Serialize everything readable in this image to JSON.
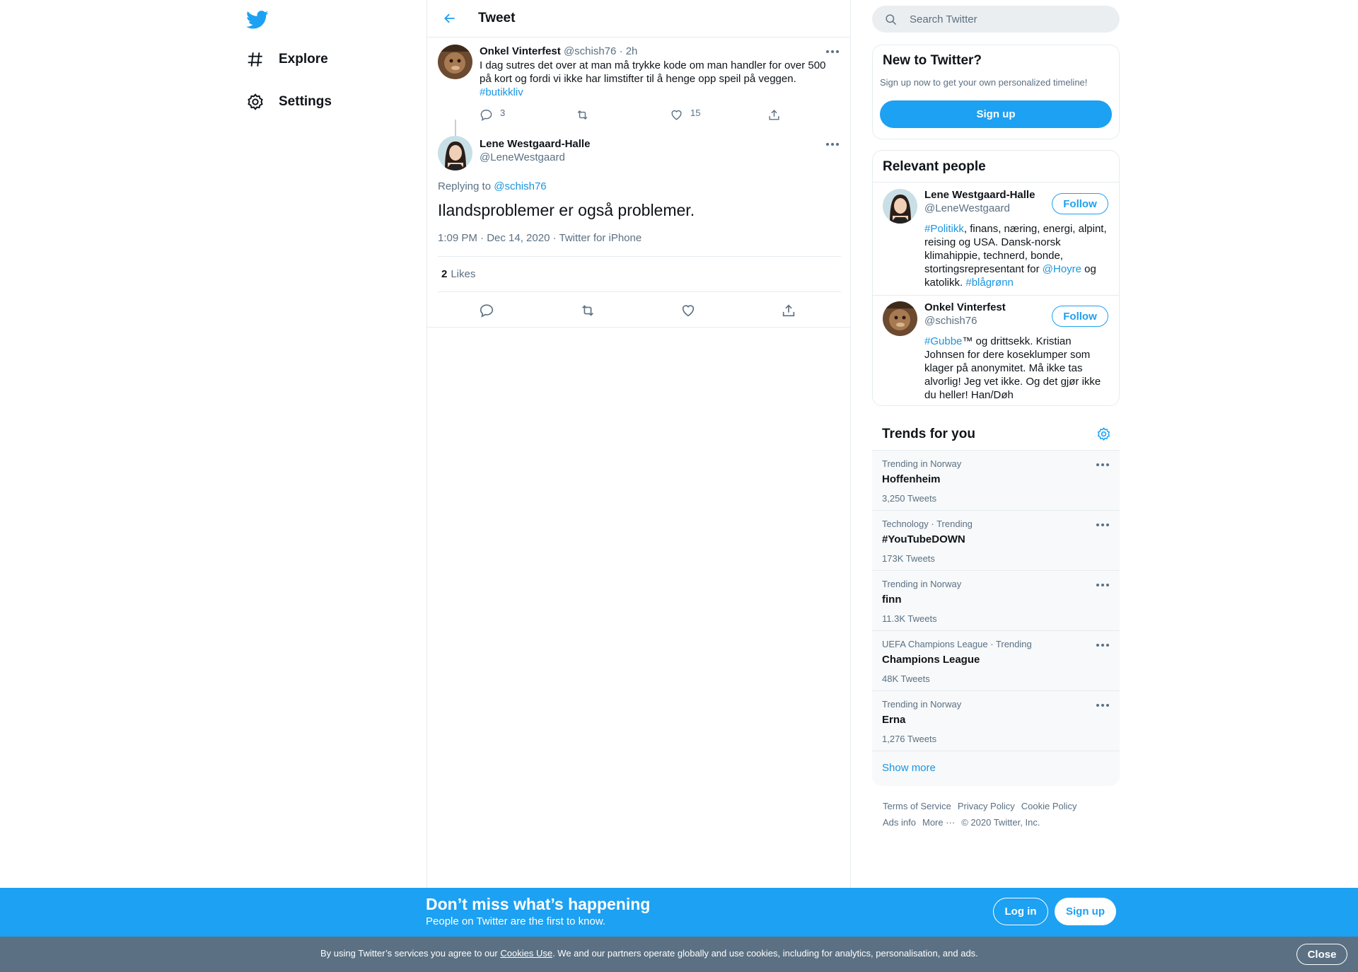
{
  "colors": {
    "accent": "#1da1f2",
    "link": "#1b95e0",
    "muted": "#5b7083",
    "cookie_bar": "#5b7083"
  },
  "nav": {
    "logo_icon": "twitter-bird-icon",
    "items": [
      {
        "label": "Explore",
        "icon": "hashtag-icon"
      },
      {
        "label": "Settings",
        "icon": "gear-icon"
      }
    ]
  },
  "header": {
    "title": "Tweet"
  },
  "parent_tweet": {
    "name": "Onkel Vinterfest",
    "handle": "@schish76",
    "time": "· 2h",
    "text": "I dag sutres det over at man må trykke kode om man handler for over 500 på kort og fordi vi ikke har limstifter til å henge opp speil på veggen.",
    "hashtag": "#butikkliv",
    "reply_count": "3",
    "like_count": "15"
  },
  "main_tweet": {
    "name": "Lene Westgaard-Halle",
    "handle": "@LeneWestgaard",
    "replying_prefix": "Replying to",
    "replying_to": "@schish76",
    "text": "Ilandsproblemer er også problemer.",
    "timestamp": "1:09 PM · Dec 14, 2020 · Twitter for iPhone",
    "like_count": "2",
    "like_label": "Likes"
  },
  "search": {
    "placeholder": "Search Twitter"
  },
  "new_to_twitter": {
    "title": "New to Twitter?",
    "subtitle": "Sign up now to get your own personalized timeline!",
    "button": "Sign up"
  },
  "relevant_people": {
    "title": "Relevant people",
    "follow_label": "Follow",
    "people": [
      {
        "name": "Lene Westgaard-Halle",
        "handle": "@LeneWestgaard",
        "bio_tag": "#Politikk",
        "bio_1": ", finans, næring, energi, alpint, reising og USA. Dansk-norsk klimahippie, technerd, bonde, stortingsrepresentant for ",
        "bio_mention": "@Hoyre",
        "bio_2": " og katolikk. ",
        "bio_tag2": "#blågrønn"
      },
      {
        "name": "Onkel Vinterfest",
        "handle": "@schish76",
        "bio_tag": "#Gubbe",
        "bio_1": "™ og drittsekk. Kristian Johnsen for dere koseklumper som klager på anonymitet. Må ikke tas alvorlig! Jeg vet ikke. Og det gjør ikke du heller! Han/Døh"
      }
    ]
  },
  "trends": {
    "title": "Trends for you",
    "items": [
      {
        "context": "Trending in Norway",
        "name": "Hoffenheim",
        "count": "3,250 Tweets"
      },
      {
        "context": "Technology · Trending",
        "name": "#YouTubeDOWN",
        "count": "173K Tweets"
      },
      {
        "context": "Trending in Norway",
        "name": "finn",
        "count": "11.3K Tweets"
      },
      {
        "context": "UEFA Champions League · Trending",
        "name": "Champions League",
        "count": "48K Tweets"
      },
      {
        "context": "Trending in Norway",
        "name": "Erna",
        "count": "1,276 Tweets"
      }
    ],
    "show_more": "Show more"
  },
  "footer": {
    "terms": "Terms of Service",
    "privacy": "Privacy Policy",
    "cookie": "Cookie Policy",
    "ads": "Ads info",
    "more": "More ···",
    "copyright": "© 2020 Twitter, Inc."
  },
  "banner": {
    "title": "Don’t miss what’s happening",
    "subtitle": "People on Twitter are the first to know.",
    "login": "Log in",
    "signup": "Sign up"
  },
  "cookie_bar": {
    "prefix": "By using Twitter’s services you agree to our ",
    "link": "Cookies Use",
    "suffix": ". We and our partners operate globally and use cookies, including for analytics, personalisation, and ads.",
    "close": "Close"
  }
}
